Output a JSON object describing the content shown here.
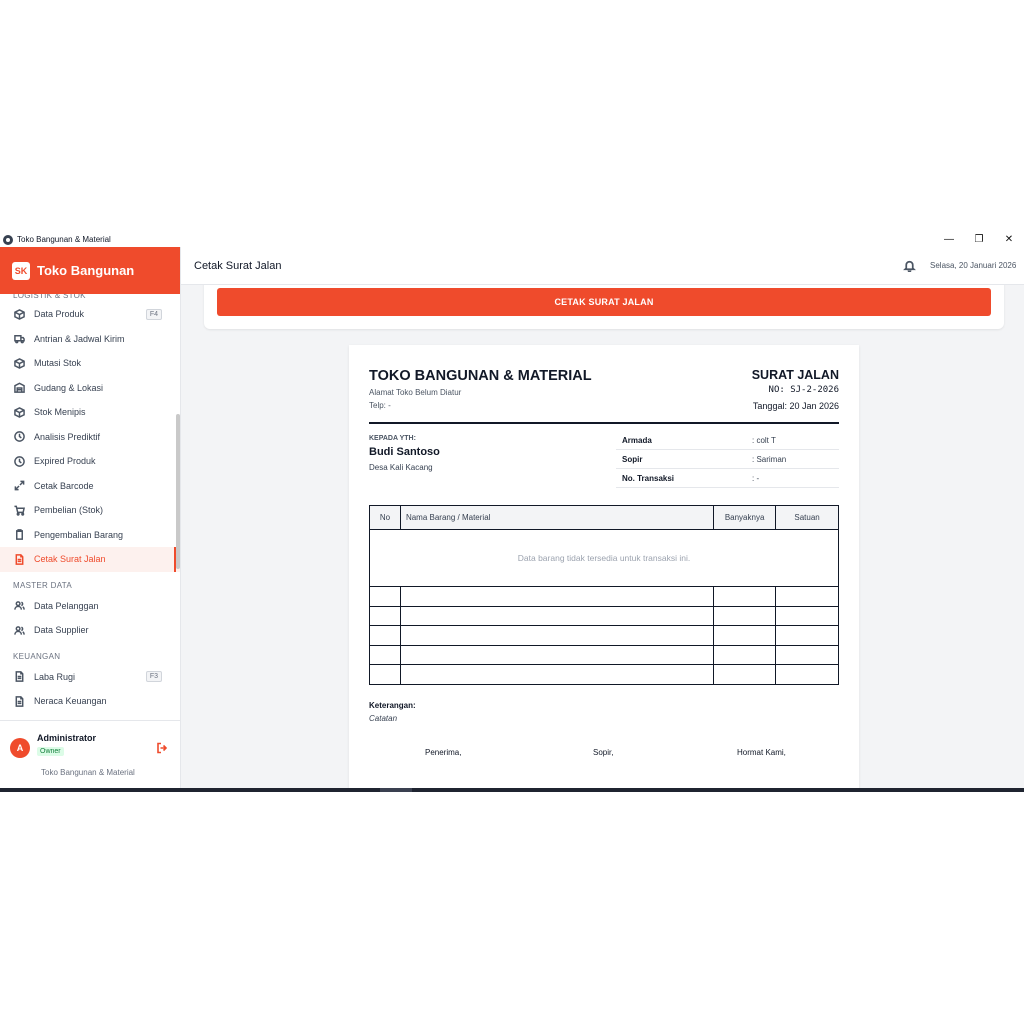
{
  "window": {
    "title": "Toko Bangunan & Material",
    "minimize": "—",
    "restore": "❐",
    "close": "✕"
  },
  "brand": {
    "logo": "SK",
    "name": "Toko Bangunan"
  },
  "sidebar": {
    "sections": [
      {
        "title": "LOGISTIK & STOK"
      },
      {
        "title": "MASTER DATA"
      },
      {
        "title": "KEUANGAN"
      }
    ],
    "items": [
      {
        "label": "Data Produk",
        "kbd": "F4"
      },
      {
        "label": "Antrian & Jadwal Kirim"
      },
      {
        "label": "Mutasi Stok"
      },
      {
        "label": "Gudang & Lokasi"
      },
      {
        "label": "Stok Menipis"
      },
      {
        "label": "Analisis Prediktif"
      },
      {
        "label": "Expired Produk"
      },
      {
        "label": "Cetak Barcode"
      },
      {
        "label": "Pembelian (Stok)"
      },
      {
        "label": "Pengembalian Barang"
      },
      {
        "label": "Cetak Surat Jalan",
        "active": true
      },
      {
        "label": "Data Pelanggan"
      },
      {
        "label": "Data Supplier"
      },
      {
        "label": "Laba Rugi",
        "kbd": "F3"
      },
      {
        "label": "Neraca Keuangan"
      }
    ]
  },
  "user": {
    "initial": "A",
    "name": "Administrator",
    "role": "Owner",
    "store": "Toko Bangunan & Material"
  },
  "header": {
    "title": "Cetak Surat Jalan",
    "date": "Selasa, 20 Januari 2026"
  },
  "toolbar": {
    "print_label": "CETAK SURAT JALAN"
  },
  "document": {
    "store_name": "TOKO BANGUNAN & MATERIAL",
    "address": "Alamat Toko Belum Diatur",
    "phone": "Telp: -",
    "title": "SURAT JALAN",
    "number": "NO: SJ-2-2026",
    "date": "Tanggal: 20 Jan 2026",
    "to_label": "KEPADA YTH:",
    "customer_name": "Budi Santoso",
    "customer_address": "Desa Kali Kacang",
    "info": [
      {
        "key": "Armada",
        "value": ": colt T"
      },
      {
        "key": "Sopir",
        "value": ": Sariman"
      },
      {
        "key": "No. Transaksi",
        "value": ": -"
      }
    ],
    "columns": [
      "No",
      "Nama Barang / Material",
      "Banyaknya",
      "Satuan"
    ],
    "empty_message": "Data barang tidak tersedia untuk transaksi ini.",
    "note_label": "Keterangan:",
    "note_value": "Catatan",
    "signatures": [
      "Penerima,",
      "Sopir,",
      "Hormat Kami,"
    ]
  },
  "colors": {
    "accent": "#ef4b2c"
  }
}
